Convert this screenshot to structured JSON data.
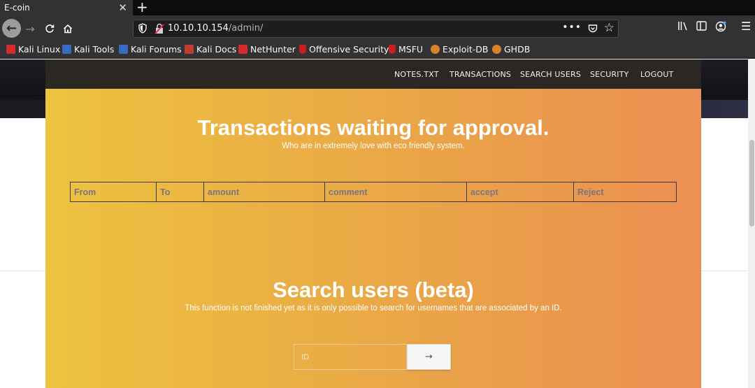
{
  "browser": {
    "tab_title": "E-coin",
    "tab_close": "✕",
    "new_tab": "+",
    "url_host": "10.10.10.154",
    "url_path": "/admin/",
    "url_dots": "•••"
  },
  "bookmarks": [
    {
      "label": "Kali Linux",
      "color": "#d42c2c"
    },
    {
      "label": "Kali Tools",
      "color": "#3a6bc4"
    },
    {
      "label": "Kali Forums",
      "color": "#3a6bc4"
    },
    {
      "label": "Kali Docs",
      "color": "#c23b2f"
    },
    {
      "label": "NetHunter",
      "color": "#d42c2c"
    },
    {
      "label": "Offensive Security",
      "color": "#c62020"
    },
    {
      "label": "MSFU",
      "color": "#c62020"
    },
    {
      "label": "Exploit-DB",
      "color": "#d9822b"
    },
    {
      "label": "GHDB",
      "color": "#d9822b"
    }
  ],
  "site_nav": {
    "notes": "NOTES.TXT",
    "transactions": "TRANSACTIONS",
    "search_users": "SEARCH USERS",
    "security": "SECURITY",
    "logout": "LOGOUT"
  },
  "transactions": {
    "title": "Transactions waiting for approval.",
    "subtitle": "Who are in extremely love with eco friendly system.",
    "columns": [
      "From",
      "To",
      "amount",
      "comment",
      "accept",
      "Reject"
    ]
  },
  "search": {
    "title": "Search users (beta)",
    "subtitle": "This function is not finished yet as it is only possible to search for usernames that are associated by an ID.",
    "placeholder": "ID",
    "button": "→"
  },
  "colors": {
    "panel_gradient_start": "#edc33f",
    "panel_gradient_end": "#ec8f54",
    "nav_bg": "#2b2723"
  }
}
